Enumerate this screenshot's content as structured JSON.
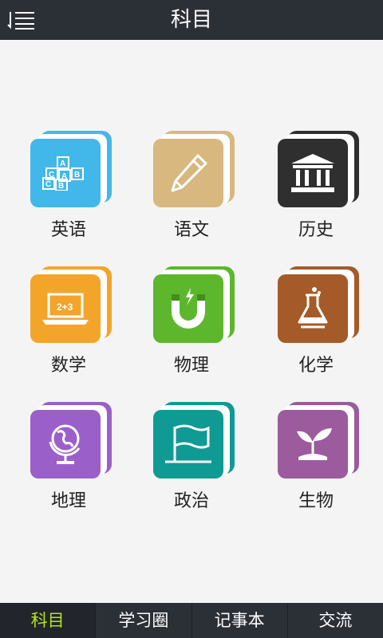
{
  "header": {
    "title": "科目",
    "menu_icon": "menu-list-icon"
  },
  "subjects": [
    {
      "label": "英语",
      "icon": "abc-blocks-icon",
      "color": "#42b8ea",
      "back": "#42b8ea"
    },
    {
      "label": "语文",
      "icon": "pencil-icon",
      "color": "#d8b87f",
      "back": "#d8b87f"
    },
    {
      "label": "历史",
      "icon": "temple-icon",
      "color": "#2f2f2f",
      "back": "#2f2f2f"
    },
    {
      "label": "数学",
      "icon": "laptop-icon",
      "color": "#f3a52a",
      "back": "#f3a52a"
    },
    {
      "label": "物理",
      "icon": "magnet-icon",
      "color": "#5db72d",
      "back": "#5db72d"
    },
    {
      "label": "化学",
      "icon": "flask-icon",
      "color": "#a45b29",
      "back": "#a45b29"
    },
    {
      "label": "地理",
      "icon": "globe-icon",
      "color": "#9b5fc9",
      "back": "#9b5fc9"
    },
    {
      "label": "政治",
      "icon": "flag-icon",
      "color": "#0f9a94",
      "back": "#0f9a94"
    },
    {
      "label": "生物",
      "icon": "sprout-icon",
      "color": "#9b5b9c",
      "back": "#9b5b9c"
    }
  ],
  "tabs": [
    {
      "label": "科目",
      "active": true
    },
    {
      "label": "学习圈",
      "active": false
    },
    {
      "label": "记事本",
      "active": false
    },
    {
      "label": "交流",
      "active": false
    }
  ]
}
